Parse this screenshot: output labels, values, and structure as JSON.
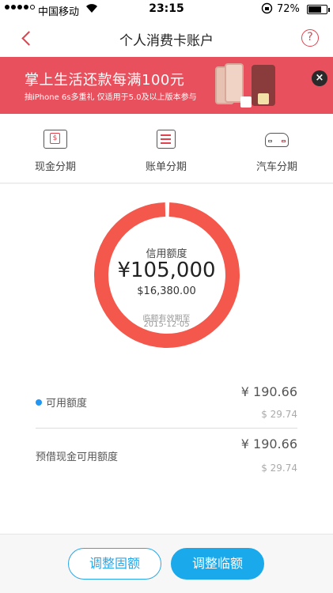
{
  "status_bar": {
    "carrier": "中国移动",
    "time": "23:15",
    "battery_percent": "72%",
    "battery_level": 0.72
  },
  "nav": {
    "title": "个人消费卡账户",
    "help_label": "?"
  },
  "banner": {
    "headline": "掌上生活还款每满100元",
    "subline": "抽iPhone 6s多重礼 仅适用于5.0及以上版本参与",
    "close_label": "×",
    "accent_color": "#e8505d"
  },
  "shortcuts": [
    {
      "label": "现金分期",
      "icon": "cash-icon"
    },
    {
      "label": "账单分期",
      "icon": "bill-icon"
    },
    {
      "label": "汽车分期",
      "icon": "car-icon"
    }
  ],
  "credit": {
    "label": "信用额度",
    "amount": "¥105,000",
    "usd_amount": "$16,380.00",
    "expiry_label": "临额有效期至",
    "expiry_date": "2015-12-05",
    "ring_color": "#f4574b",
    "ring_fraction": 0.99
  },
  "available": {
    "label": "可用额度",
    "value": "¥ 190.66",
    "sub_value": "$ 29.74",
    "dot_color": "#2196f3"
  },
  "cash_available": {
    "label": "预借现金可用额度",
    "value": "¥ 190.66",
    "sub_value": "$ 29.74"
  },
  "footer": {
    "adjust_fixed_label": "调整固额",
    "adjust_temp_label": "调整临额",
    "accent_color": "#1aa9ea"
  }
}
